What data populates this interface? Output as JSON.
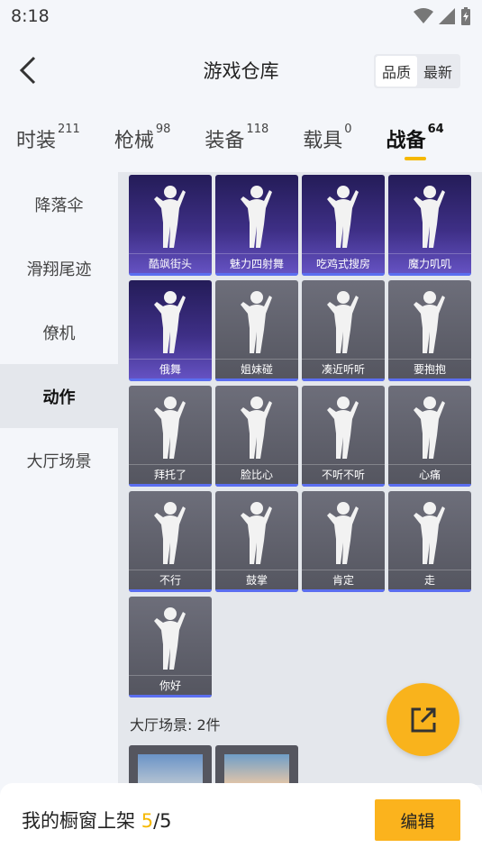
{
  "status": {
    "time": "8:18"
  },
  "header": {
    "title": "游戏仓库",
    "sort_options": [
      "品质",
      "最新"
    ],
    "active_sort": "品质"
  },
  "tabs": [
    {
      "label": "时装",
      "count": "211"
    },
    {
      "label": "枪械",
      "count": "98"
    },
    {
      "label": "装备",
      "count": "118"
    },
    {
      "label": "载具",
      "count": "0"
    },
    {
      "label": "战备",
      "count": "64"
    }
  ],
  "active_tab": "战备",
  "sidebar": {
    "items": [
      "降落伞",
      "滑翔尾迹",
      "僚机",
      "动作",
      "大厅场景"
    ],
    "active": "动作"
  },
  "emotes": [
    {
      "label": "酷飒街头",
      "rarity": "purple"
    },
    {
      "label": "魅力四射舞",
      "rarity": "purple"
    },
    {
      "label": "吃鸡式搜房",
      "rarity": "purple"
    },
    {
      "label": "魔力叽叽",
      "rarity": "purple"
    },
    {
      "label": "俄舞",
      "rarity": "purple"
    },
    {
      "label": "姐妹碰",
      "rarity": "gray"
    },
    {
      "label": "凑近听听",
      "rarity": "gray"
    },
    {
      "label": "要抱抱",
      "rarity": "gray"
    },
    {
      "label": "拜托了",
      "rarity": "gray"
    },
    {
      "label": "脸比心",
      "rarity": "gray"
    },
    {
      "label": "不听不听",
      "rarity": "gray"
    },
    {
      "label": "心痛",
      "rarity": "gray"
    },
    {
      "label": "不行",
      "rarity": "gray"
    },
    {
      "label": "鼓掌",
      "rarity": "gray"
    },
    {
      "label": "肯定",
      "rarity": "gray"
    },
    {
      "label": "走",
      "rarity": "gray"
    },
    {
      "label": "你好",
      "rarity": "gray"
    }
  ],
  "lobby_section": {
    "title": "大厅场景: 2件"
  },
  "footer": {
    "label": "我的橱窗上架",
    "count": "5",
    "total": "/5",
    "edit_label": "编辑"
  },
  "colors": {
    "accent": "#f9b31c",
    "rarity_purple": "#3e2f86",
    "rarity_gray": "#5c5d67",
    "bar_blue": "#5b6ef0"
  }
}
